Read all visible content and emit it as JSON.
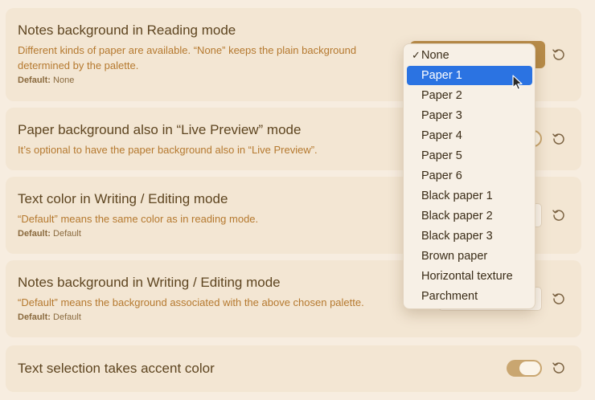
{
  "settings": [
    {
      "title": "Notes background in Reading mode",
      "desc": "Different kinds of paper are available. “None” keeps the plain background determined by the palette.",
      "default_label": "Default:",
      "default_value": "None"
    },
    {
      "title": "Paper background also in “Live Preview” mode",
      "desc": "It’s optional to have the paper background also in “Live Preview”."
    },
    {
      "title": "Text color in Writing / Editing mode",
      "desc": "“Default” means the same color as in reading mode.",
      "default_label": "Default:",
      "default_value": "Default"
    },
    {
      "title": "Notes background in Writing / Editing mode",
      "desc": "“Default” means the background associated with the above chosen palette.",
      "default_label": "Default:",
      "default_value": "Default"
    },
    {
      "title": "Text selection takes accent color"
    }
  ],
  "dropdown": {
    "selected": "None",
    "highlighted": "Paper 1",
    "check_mark": "✓",
    "options": [
      "None",
      "Paper 1",
      "Paper 2",
      "Paper 3",
      "Paper 4",
      "Paper 5",
      "Paper 6",
      "Black paper 1",
      "Black paper 2",
      "Black paper 3",
      "Brown paper",
      "Horizontal texture",
      "Parchment"
    ]
  },
  "toggles": {
    "live_preview": true,
    "text_selection_accent": true
  },
  "colors": {
    "background": "#f7ede0",
    "card": "#f3e6d3",
    "title": "#5e4520",
    "description": "#b5792f",
    "accent": "#b88c4a",
    "menu_highlight": "#2b73e2"
  },
  "icons": {
    "reset": "reset-icon",
    "cursor": "mouse-pointer-icon"
  }
}
